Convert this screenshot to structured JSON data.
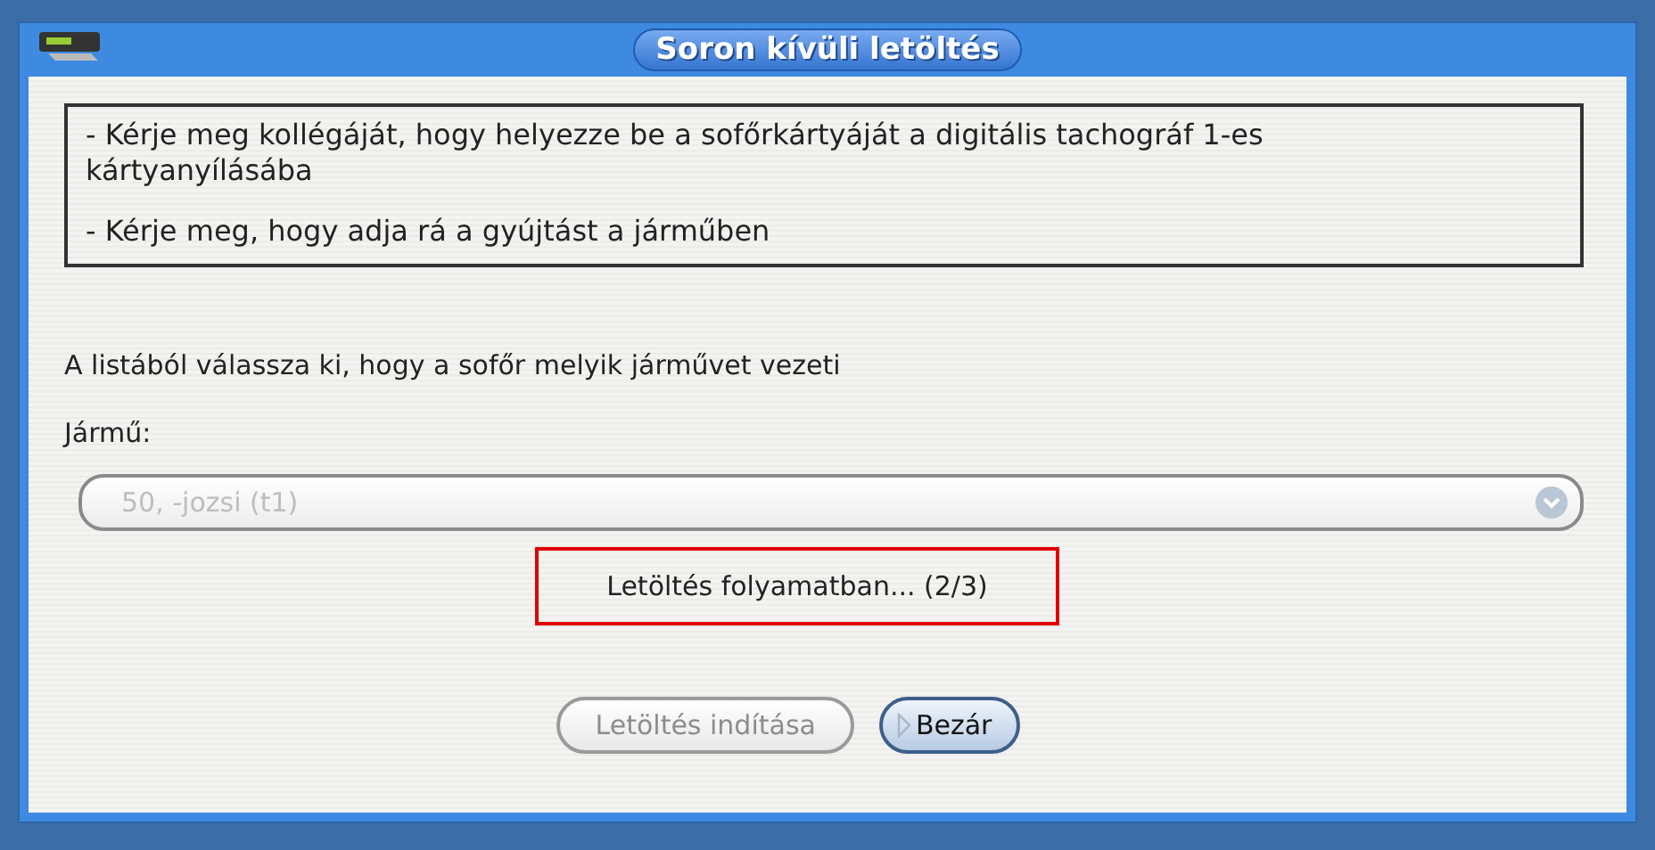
{
  "window": {
    "title": "Soron kívüli letöltés"
  },
  "instructions": [
    "- Kérje meg kollégáját, hogy helyezze be a sofőrkártyáját a digitális tachográf 1-es kártyanyílásába",
    "- Kérje meg, hogy adja rá a gyújtást a járműben"
  ],
  "prompt": "A listából válassza ki, hogy a sofőr melyik járművet vezeti",
  "vehicle": {
    "label": "Jármű:",
    "value": "50, -jozsi (t1)",
    "disabled": true
  },
  "status": "Letöltés folyamatban... (2/3)",
  "buttons": [
    {
      "label": "Letöltés indítása",
      "disabled": true,
      "kind": "start"
    },
    {
      "label": "Bezár",
      "disabled": false,
      "kind": "close"
    }
  ]
}
